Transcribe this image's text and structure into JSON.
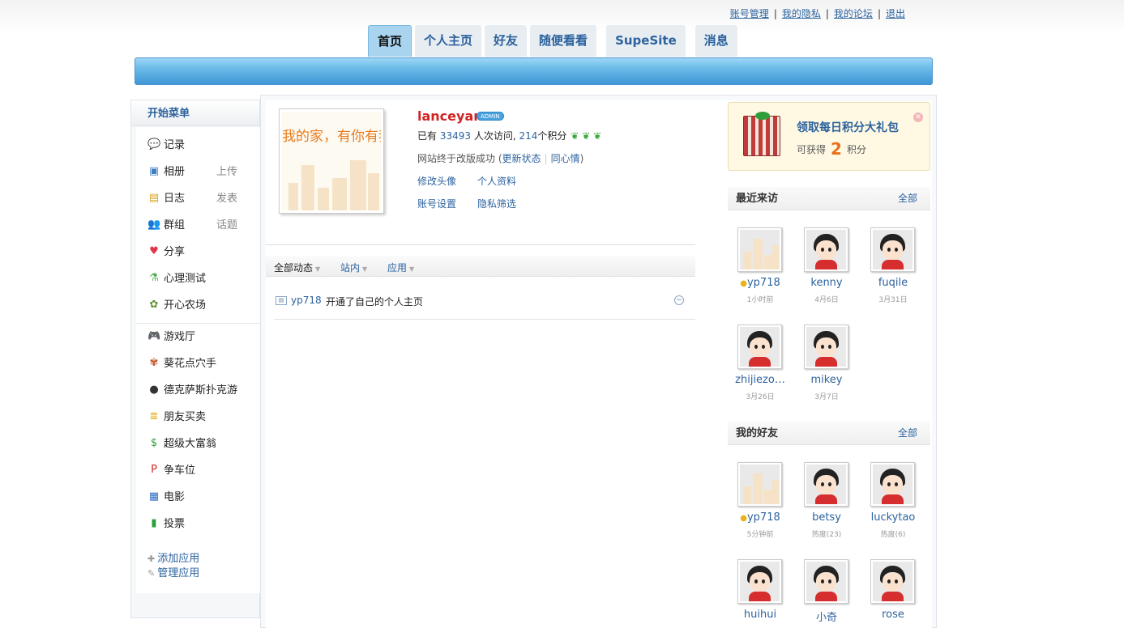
{
  "toplinks": [
    "账号管理",
    "我的隐私",
    "我的论坛",
    "退出"
  ],
  "nav": {
    "tabs": [
      {
        "label": "首页",
        "active": true
      },
      {
        "label": "个人主页",
        "active": false
      },
      {
        "label": "好友",
        "active": false
      },
      {
        "label": "随便看看",
        "active": false
      },
      {
        "label": "SupeSite",
        "active": false
      },
      {
        "label": "消息",
        "active": false
      }
    ]
  },
  "sidebar": {
    "title": "开始菜单",
    "items": [
      {
        "label": "记录",
        "icon": "speech-bubble-icon",
        "extra": ""
      },
      {
        "label": "相册",
        "icon": "photo-icon",
        "extra": "上传"
      },
      {
        "label": "日志",
        "icon": "notebook-icon",
        "extra": "发表"
      },
      {
        "label": "群组",
        "icon": "group-icon",
        "extra": "话题"
      },
      {
        "label": "分享",
        "icon": "hearts-icon",
        "extra": ""
      },
      {
        "label": "心理测试",
        "icon": "flask-icon",
        "extra": ""
      },
      {
        "label": "开心农场",
        "icon": "sprout-icon",
        "extra": ""
      }
    ],
    "apps": [
      {
        "label": "游戏厅",
        "icon": "gamepad-icon"
      },
      {
        "label": "葵花点穴手",
        "icon": "flower-icon"
      },
      {
        "label": "德克萨斯扑克游",
        "icon": "poker-chip-icon"
      },
      {
        "label": "朋友买卖",
        "icon": "coins-icon"
      },
      {
        "label": "超级大富翁",
        "icon": "money-icon"
      },
      {
        "label": "争车位",
        "icon": "parking-icon"
      },
      {
        "label": "电影",
        "icon": "clapperboard-icon"
      },
      {
        "label": "投票",
        "icon": "bar-chart-icon"
      }
    ],
    "add_app": "添加应用",
    "manage_app": "管理应用"
  },
  "profile": {
    "avatar_text": "我的家，有你有我",
    "username": "lanceyan",
    "badge": "ADMIN",
    "stats_prefix": "已有",
    "visits": "33493",
    "visits_suffix": "人次访问,",
    "points": "214",
    "points_suffix": "个积分",
    "status_text": "网站终于改版成功",
    "update_status": "更新状态",
    "same_mood": "同心情",
    "links": [
      "修改头像",
      "个人资料",
      "账号设置",
      "隐私筛选"
    ]
  },
  "feed": {
    "tabs": [
      "全部动态",
      "站内",
      "应用"
    ],
    "items": [
      {
        "user": "yp718",
        "text": "开通了自己的个人主页"
      }
    ]
  },
  "gift": {
    "title": "领取每日积分大礼包",
    "sub_prefix": "可获得",
    "amount": "2",
    "sub_suffix": "积分"
  },
  "visitors": {
    "title": "最近来访",
    "all": "全部",
    "users": [
      {
        "name": "yp718",
        "time": "1小时前",
        "avatar": "town",
        "online": true
      },
      {
        "name": "kenny",
        "time": "4月6日",
        "avatar": "doll",
        "online": false
      },
      {
        "name": "fuqile",
        "time": "3月31日",
        "avatar": "doll",
        "online": false
      },
      {
        "name": "zhijiezo…",
        "time": "3月26日",
        "avatar": "doll",
        "online": false
      },
      {
        "name": "mikey",
        "time": "3月7日",
        "avatar": "doll",
        "online": false
      }
    ]
  },
  "friends": {
    "title": "我的好友",
    "all": "全部",
    "users": [
      {
        "name": "yp718",
        "time": "5分钟前",
        "avatar": "town",
        "online": true
      },
      {
        "name": "betsy",
        "time": "热度(23)",
        "avatar": "doll",
        "online": false
      },
      {
        "name": "luckytao",
        "time": "热度(6)",
        "avatar": "doll",
        "online": false
      },
      {
        "name": "huihui",
        "time": "",
        "avatar": "doll",
        "online": false
      },
      {
        "name": "小奇",
        "time": "",
        "avatar": "doll",
        "online": false
      },
      {
        "name": "rose",
        "time": "",
        "avatar": "doll",
        "online": false
      }
    ]
  },
  "colors": {
    "link": "#2c629e",
    "username": "#d32222",
    "header_bar": "#4b9bd8",
    "points_orange": "#e8701a"
  }
}
